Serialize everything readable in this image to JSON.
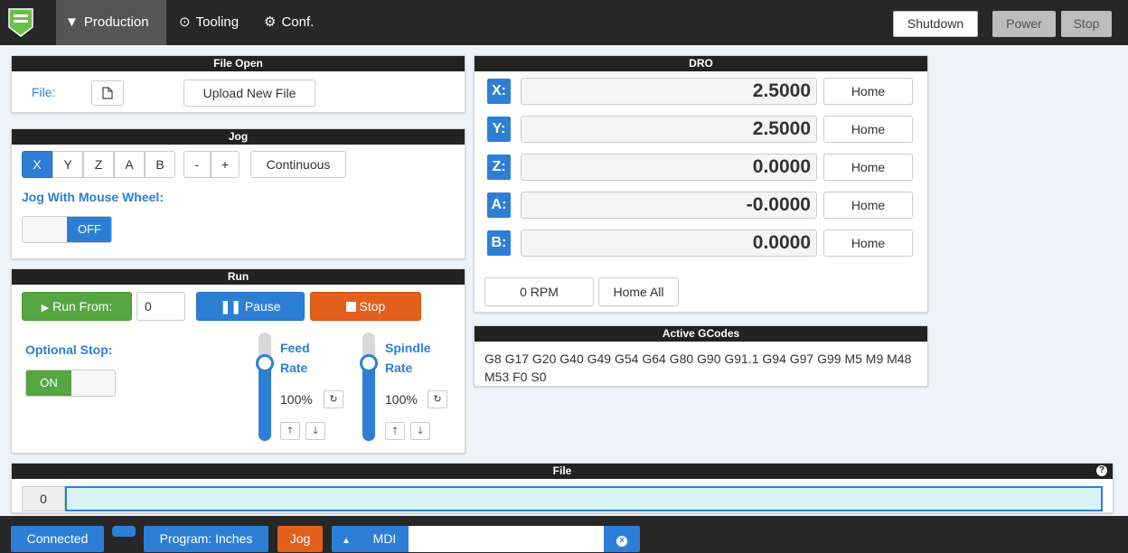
{
  "nav": {
    "tabs": [
      {
        "label": "Production",
        "icon": "funnel-icon"
      },
      {
        "label": "Tooling",
        "icon": "play-circle-icon"
      },
      {
        "label": "Conf.",
        "icon": "gears-icon"
      }
    ],
    "shutdown_label": "Shutdown",
    "power_label": "Power",
    "stop_label": "Stop"
  },
  "file_open": {
    "title": "File Open",
    "file_label": "File:",
    "upload_label": "Upload New File"
  },
  "jog": {
    "title": "Jog",
    "axes": [
      "X",
      "Y",
      "Z",
      "A",
      "B"
    ],
    "selected_axis": "X",
    "minus": "-",
    "plus": "+",
    "continuous_label": "Continuous",
    "mouse_wheel_label": "Jog With Mouse Wheel:",
    "mouse_wheel_state": "OFF"
  },
  "run": {
    "title": "Run",
    "run_from_label": "Run From:",
    "run_from_value": "0",
    "pause_label": "Pause",
    "stop_label": "Stop",
    "optional_stop_label": "Optional Stop:",
    "optional_stop_state": "ON",
    "feed_rate_label_1": "Feed",
    "feed_rate_label_2": "Rate",
    "feed_rate_value": "100%",
    "feed_rate_level": 0.72,
    "spindle_rate_label_1": "Spindle",
    "spindle_rate_label_2": "Rate",
    "spindle_rate_value": "100%",
    "spindle_rate_level": 0.72
  },
  "dro": {
    "title": "DRO",
    "rows": [
      {
        "axis": "X:",
        "value": "2.5000",
        "home_label": "Home"
      },
      {
        "axis": "Y:",
        "value": "2.5000",
        "home_label": "Home"
      },
      {
        "axis": "Z:",
        "value": "0.0000",
        "home_label": "Home"
      },
      {
        "axis": "A:",
        "value": "-0.0000",
        "home_label": "Home"
      },
      {
        "axis": "B:",
        "value": "0.0000",
        "home_label": "Home"
      }
    ],
    "rpm": "0 RPM",
    "home_all_label": "Home All"
  },
  "gcodes": {
    "title": "Active GCodes",
    "text": "G8 G17 G20 G40 G49 G54 G64 G80 G90 G91.1 G94 G97 G99 M5 M9 M48 M53 F0 S0"
  },
  "file_panel": {
    "title": "File",
    "line_number": "0",
    "help_icon": "question-circle-icon"
  },
  "status": {
    "connected_label": "Connected",
    "program_units": "Program: Inches",
    "jog_label": "Jog",
    "mdi_label": "MDI",
    "mdi_value": ""
  }
}
